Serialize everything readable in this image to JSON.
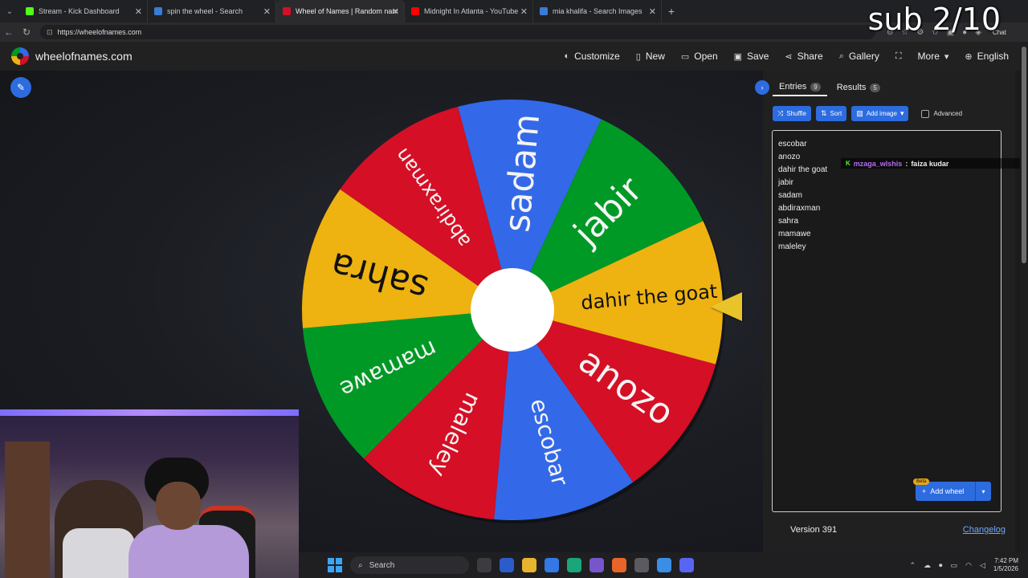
{
  "browser": {
    "tabs": [
      {
        "title": "Stream - Kick Dashboard",
        "color": "#53fc18",
        "active": false
      },
      {
        "title": "spin the wheel - Search",
        "color": "#3a7bd5",
        "active": false
      },
      {
        "title": "Wheel of Names | Random name p",
        "color": "#d50f25",
        "active": true
      },
      {
        "title": "Midnight In Atlanta - YouTube",
        "color": "#ff0000",
        "active": false
      },
      {
        "title": "mia khalifa - Search Images",
        "color": "#3a7bd5",
        "active": false
      }
    ],
    "url": "https://wheelofnames.com",
    "chat_label": "Chat"
  },
  "overlay": {
    "sub_counter": "sub 2/10"
  },
  "site": {
    "name": "wheelofnames.com",
    "menu": [
      {
        "label": "Customize",
        "icon": "palette-icon"
      },
      {
        "label": "New",
        "icon": "file-icon"
      },
      {
        "label": "Open",
        "icon": "folder-icon"
      },
      {
        "label": "Save",
        "icon": "save-icon"
      },
      {
        "label": "Share",
        "icon": "share-icon"
      },
      {
        "label": "Gallery",
        "icon": "search-icon"
      },
      {
        "label": "",
        "icon": "fullscreen-icon"
      },
      {
        "label": "More",
        "icon": "chevron-down-icon"
      },
      {
        "label": "English",
        "icon": "globe-icon"
      }
    ]
  },
  "wheel": {
    "colors": [
      "#3369e8",
      "#009925",
      "#eeb211",
      "#d50f25"
    ],
    "segments": [
      "dahir the goat",
      "anozo",
      "escobar",
      "maleley",
      "mamawe",
      "sahra",
      "abdiraxman",
      "sadam",
      "jabir"
    ]
  },
  "panel": {
    "tabs": {
      "entries_label": "Entries",
      "entries_count": "9",
      "results_label": "Results",
      "results_count": "5"
    },
    "toolbar": {
      "shuffle": "Shuffle",
      "sort": "Sort",
      "add_image": "Add image",
      "advanced": "Advanced"
    },
    "entries": [
      "escobar",
      "anozo",
      "dahir the goat",
      "jabir",
      "sadam",
      "abdiraxman",
      "sahra",
      "mamawe",
      "maleley"
    ],
    "chat": {
      "user": "mzaga_wlshis",
      "message": "faiza kudar"
    },
    "add_wheel": "Add wheel",
    "beta": "Beta",
    "version": "Version 391",
    "changelog": "Changelog"
  },
  "taskbar": {
    "search": "Search",
    "time": "7:42 PM",
    "date": "1/5/2026"
  }
}
